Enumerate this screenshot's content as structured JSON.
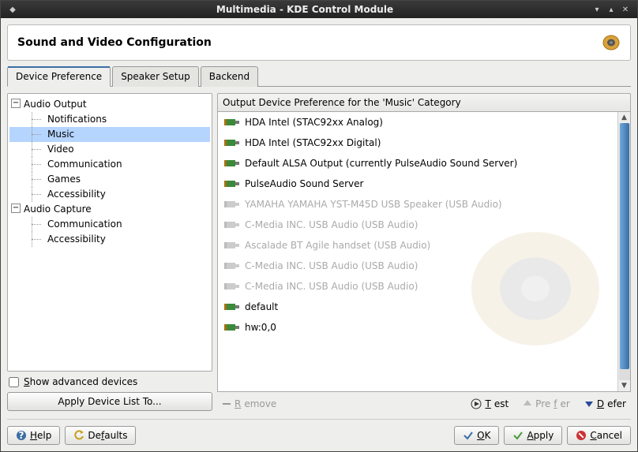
{
  "window": {
    "title": "Multimedia - KDE Control Module"
  },
  "header": {
    "title": "Sound and Video Configuration"
  },
  "tabs": [
    {
      "label": "Device Preference",
      "active": true
    },
    {
      "label": "Speaker Setup",
      "active": false
    },
    {
      "label": "Backend",
      "active": false
    }
  ],
  "tree": {
    "audio_output": {
      "label": "Audio Output"
    },
    "notifications": {
      "label": "Notifications"
    },
    "music": {
      "label": "Music"
    },
    "video": {
      "label": "Video"
    },
    "communication": {
      "label": "Communication"
    },
    "games": {
      "label": "Games"
    },
    "accessibility": {
      "label": "Accessibility"
    },
    "audio_capture": {
      "label": "Audio Capture"
    },
    "cap_communication": {
      "label": "Communication"
    },
    "cap_accessibility": {
      "label": "Accessibility"
    }
  },
  "show_advanced": {
    "label": "Show advanced devices",
    "checked": false
  },
  "apply_list_btn": "Apply Device List To...",
  "list_header": "Output Device Preference for the 'Music' Category",
  "devices": [
    {
      "label": "HDA Intel (STAC92xx Analog)",
      "dim": false
    },
    {
      "label": "HDA Intel (STAC92xx Digital)",
      "dim": false
    },
    {
      "label": "Default ALSA Output (currently PulseAudio Sound Server)",
      "dim": false
    },
    {
      "label": "PulseAudio Sound Server",
      "dim": false
    },
    {
      "label": "YAMAHA YAMAHA YST-M45D USB Speaker (USB Audio)",
      "dim": true
    },
    {
      "label": "C-Media INC. USB Audio (USB Audio)",
      "dim": true
    },
    {
      "label": "Ascalade BT Agile handset (USB Audio)",
      "dim": true
    },
    {
      "label": "C-Media INC. USB Audio (USB Audio)",
      "dim": true
    },
    {
      "label": "C-Media INC. USB Audio (USB Audio)",
      "dim": true
    },
    {
      "label": "default",
      "dim": false
    },
    {
      "label": "hw:0,0",
      "dim": false
    }
  ],
  "actions": {
    "remove": "Remove",
    "test": "Test",
    "prefer": "Prefer",
    "defer": "Defer"
  },
  "footer": {
    "help": "Help",
    "defaults": "Defaults",
    "ok": "OK",
    "apply": "Apply",
    "cancel": "Cancel"
  },
  "colors": {
    "selection": "#b5d5ff",
    "accent": "#3a6ea5"
  }
}
